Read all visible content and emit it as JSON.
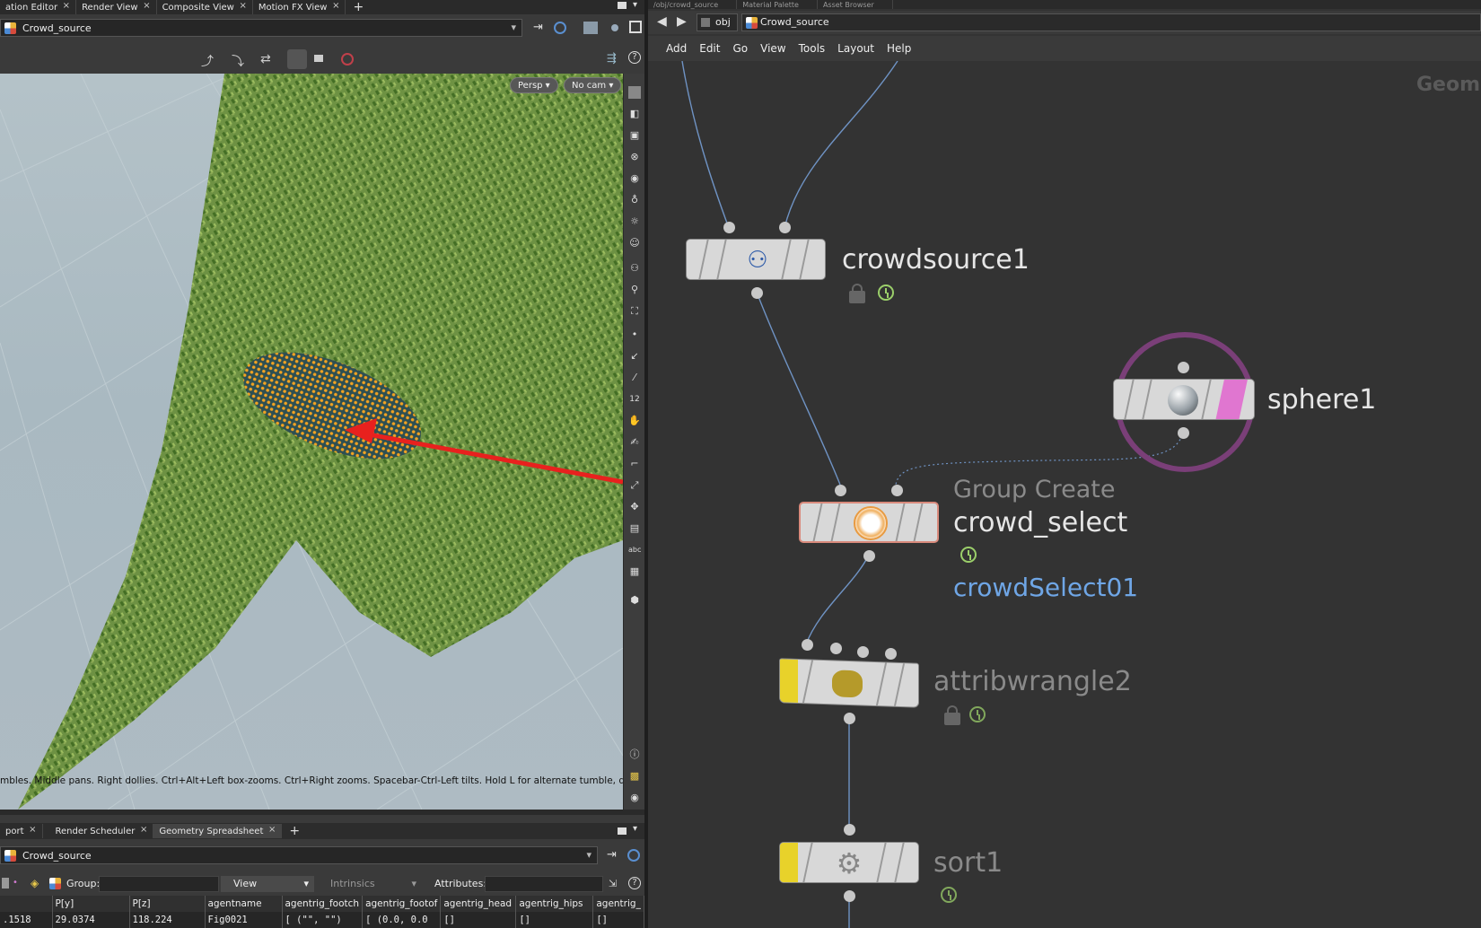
{
  "left_panel": {
    "tabs": [
      "ation Editor",
      "Render View",
      "Composite View",
      "Motion FX View"
    ],
    "path": "Crowd_source",
    "viewport": {
      "persp_label": "Persp ▾",
      "cam_label": "No cam ▾",
      "hint": "mbles. Middle pans. Right dollies. Ctrl+Alt+Left box-zooms. Ctrl+Right zooms. Spacebar-Ctrl-Left tilts. Hold L for alternate tumble, dolly, and"
    },
    "right_strip_icons": [
      "abc"
    ]
  },
  "bottom_panel": {
    "tabs": [
      "port",
      "Render Scheduler",
      "Geometry Spreadsheet"
    ],
    "active_tab": "Geometry Spreadsheet",
    "path": "Crowd_source",
    "group_label": "Group:",
    "view_select": "View",
    "intrinsics_select": "Intrinsics",
    "attributes_label": "Attributes:",
    "columns": [
      "",
      "P[y]",
      "P[z]",
      "agentname",
      "agentrig_footch",
      "agentrig_footof",
      "agentrig_head",
      "agentrig_hips",
      "agentrig_"
    ],
    "row": [
      ".1518",
      "29.0374",
      "118.224",
      "Fig0021",
      "[ (\"\", \"\")",
      "[ (0.0, 0.0",
      "[]",
      "[]",
      "[]"
    ]
  },
  "network": {
    "top_tabs": [
      "/obj/crowd_source",
      "Material Palette",
      "Asset Browser"
    ],
    "breadcrumb": [
      "obj",
      "Crowd_source"
    ],
    "menu": [
      "Add",
      "Edit",
      "Go",
      "View",
      "Tools",
      "Layout",
      "Help"
    ],
    "context_label": "Geome",
    "nodes": {
      "crowdsource": {
        "name": "crowdsource1"
      },
      "sphere": {
        "name": "sphere1"
      },
      "group": {
        "type": "Group Create",
        "name": "crowd_select",
        "comment": "crowdSelect01"
      },
      "wrangle": {
        "name": "attribwrangle2"
      },
      "sort": {
        "name": "sort1"
      }
    }
  },
  "colors": {
    "accent_red": "#e8211e",
    "node_comment_blue": "#6fa6e6",
    "sphere_ring": "#7a3f78",
    "display_flag_yellow": "#e8d22a",
    "sphere_flag_pink": "#e076d0"
  }
}
